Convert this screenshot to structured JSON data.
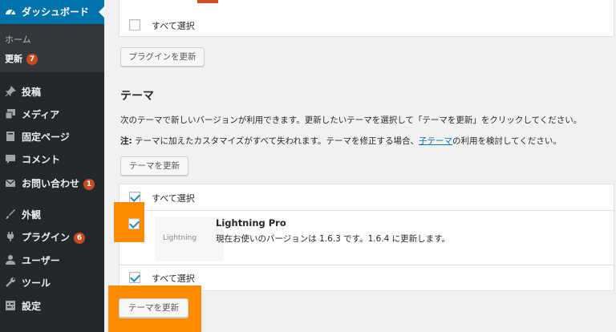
{
  "sidebar": {
    "dashboard": "ダッシュボード",
    "home": "ホーム",
    "updates": "更新",
    "updates_count": "7",
    "items": [
      {
        "label": "投稿",
        "icon": "pin-icon"
      },
      {
        "label": "メディア",
        "icon": "media-icon"
      },
      {
        "label": "固定ページ",
        "icon": "page-icon"
      },
      {
        "label": "コメント",
        "icon": "comment-icon"
      },
      {
        "label": "お問い合わせ",
        "icon": "mail-icon",
        "badge": "1"
      },
      {
        "label": "外観",
        "icon": "brush-icon"
      },
      {
        "label": "プラグイン",
        "icon": "plugin-icon",
        "badge": "6"
      },
      {
        "label": "ユーザー",
        "icon": "user-icon"
      },
      {
        "label": "ツール",
        "icon": "wrench-icon"
      },
      {
        "label": "設定",
        "icon": "settings-icon"
      }
    ]
  },
  "plugins": {
    "select_all": "すべて選択",
    "update_button": "プラグインを更新"
  },
  "themes": {
    "heading": "テーマ",
    "description": "次のテーマで新しいバージョンが利用できます。更新したいテーマを選択して「テーマを更新」をクリックしてください。",
    "note_label": "注:",
    "note_text": " テーマに加えたカスタマイズがすべて失われます。テーマを修正する場合、",
    "note_link": "子テーマ",
    "note_tail": "の利用を検討してください。",
    "update_button_top": "テーマを更新",
    "select_all_top": "すべて選択",
    "theme_name": "Lightning Pro",
    "theme_thumb_label": "Lightning",
    "theme_version": "現在お使いのバージョンは 1.6.3 です。1.6.4 に更新します。",
    "select_all_bottom": "すべて選択",
    "update_button_bottom": "テーマを更新"
  },
  "colors": {
    "sidebar_bg": "#23282d",
    "active_bg": "#0073aa",
    "badge": "#ca4a1f",
    "highlight": "#ff8c00"
  }
}
